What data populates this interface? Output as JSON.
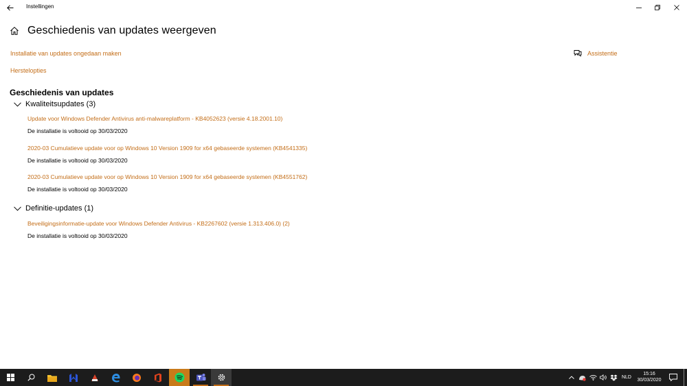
{
  "window": {
    "app_title": "Instellingen"
  },
  "header": {
    "title": "Geschiedenis van updates weergeven"
  },
  "links": {
    "uninstall": "Installatie van updates ongedaan maken",
    "recovery": "Herstelopties",
    "help": "Assistentie"
  },
  "history": {
    "title": "Geschiedenis van updates",
    "groups": [
      {
        "label": "Kwaliteitsupdates (3)",
        "items": [
          {
            "name": "Update voor Windows Defender Antivirus anti-malwareplatform - KB4052623 (versie 4.18.2001.10)",
            "status": "De installatie is voltooid op 30/03/2020"
          },
          {
            "name": "2020-03 Cumulatieve update voor op Windows 10 Version 1909 for x64 gebaseerde systemen (KB4541335)",
            "status": "De installatie is voltooid op 30/03/2020"
          },
          {
            "name": "2020-03 Cumulatieve update voor op Windows 10 Version 1909 for x64 gebaseerde systemen (KB4551762)",
            "status": "De installatie is voltooid op 30/03/2020"
          }
        ]
      },
      {
        "label": "Definitie-updates (1)",
        "items": [
          {
            "name": "Beveiligingsinformatie-update voor Windows Defender Antivirus - KB2267602 (versie 1.313.406.0) (2)",
            "status": "De installatie is voltooid op 30/03/2020"
          }
        ]
      }
    ]
  },
  "taskbar": {
    "language": "NLD",
    "time": "15:16",
    "date": "30/03/2020"
  },
  "colors": {
    "accent": "#c36d17",
    "taskbar": "#1c1c1c"
  }
}
